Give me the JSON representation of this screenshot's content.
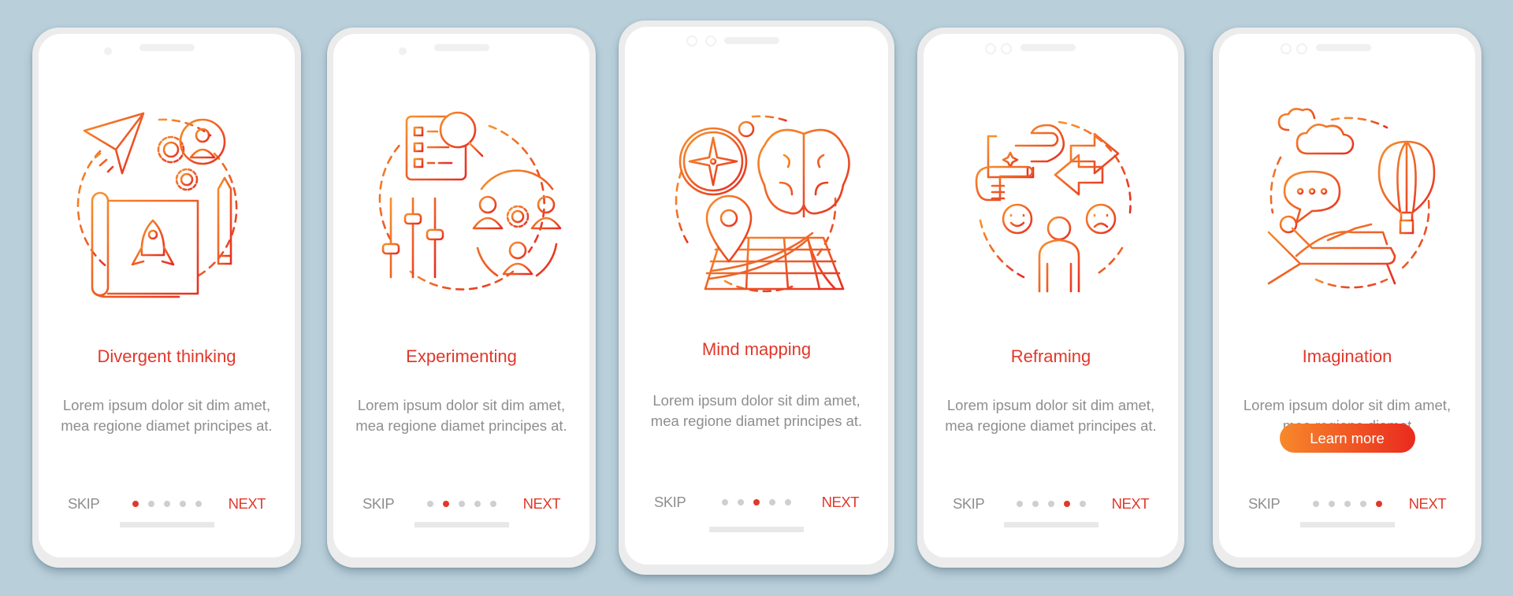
{
  "colors": {
    "background": "#b9cfda",
    "accent": "#e0382a",
    "gradient_start": "#f7892b",
    "gradient_end": "#ea2a1e",
    "inactive_dot": "#cfcfcf",
    "body_text": "#8e8e8e"
  },
  "screens": [
    {
      "illustration": "divergent-thinking-icon",
      "title": "Divergent thinking",
      "body": "Lorem ipsum dolor sit dim amet, mea regione diamet principes at.",
      "skip_label": "SKIP",
      "next_label": "NEXT",
      "active_step": 1,
      "total_steps": 5
    },
    {
      "illustration": "experimenting-icon",
      "title": "Experimenting",
      "body": "Lorem ipsum dolor sit dim amet, mea regione diamet principes at.",
      "skip_label": "SKIP",
      "next_label": "NEXT",
      "active_step": 2,
      "total_steps": 5
    },
    {
      "illustration": "mind-mapping-icon",
      "title": "Mind mapping",
      "body": "Lorem ipsum dolor sit dim amet, mea regione diamet principes at.",
      "skip_label": "SKIP",
      "next_label": "NEXT",
      "active_step": 3,
      "total_steps": 5
    },
    {
      "illustration": "reframing-icon",
      "title": "Reframing",
      "body": "Lorem ipsum dolor sit dim amet, mea regione diamet principes at.",
      "skip_label": "SKIP",
      "next_label": "NEXT",
      "active_step": 4,
      "total_steps": 5
    },
    {
      "illustration": "imagination-icon",
      "title": "Imagination",
      "body": "Lorem ipsum dolor sit dim amet, mea regione diamet",
      "button_label": "Learn more",
      "skip_label": "SKIP",
      "next_label": "NEXT",
      "active_step": 5,
      "total_steps": 5
    }
  ]
}
